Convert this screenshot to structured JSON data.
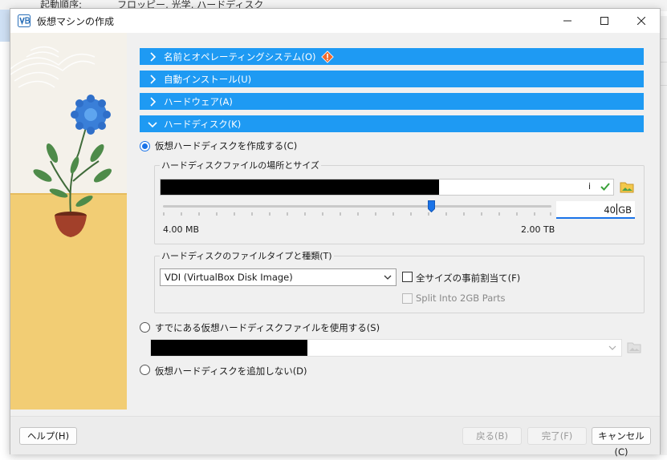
{
  "background": {
    "label": "起動順序:",
    "value": "フロッピー, 光学, ハードディスク"
  },
  "window": {
    "title": "仮想マシンの作成",
    "icon": "virtualbox-icon",
    "controls": [
      "minimize-icon",
      "maximize-icon",
      "close-icon"
    ]
  },
  "sections": [
    {
      "label": "名前とオペレーティングシステム(O)",
      "expanded": false,
      "warning": true
    },
    {
      "label": "自動インストール(U)",
      "expanded": false,
      "warning": false
    },
    {
      "label": "ハードウェア(A)",
      "expanded": false,
      "warning": false
    },
    {
      "label": "ハードディスク(K)",
      "expanded": true,
      "warning": false
    }
  ],
  "harddisk": {
    "create_option": "仮想ハードディスクを作成する(C)",
    "location_group": "ハードディスクファイルの場所とサイズ",
    "path_suffix": "i",
    "size": {
      "value": "40",
      "unit": "GB",
      "min_label": "4.00 MB",
      "max_label": "2.00 TB"
    },
    "type_group": "ハードディスクのファイルタイプと種類(T)",
    "file_type": "VDI (VirtualBox Disk Image)",
    "preallocate_label": "全サイズの事前割当て(F)",
    "split_label": "Split Into 2GB Parts",
    "existing_option": "すでにある仮想ハードディスクファイルを使用する(S)",
    "none_option": "仮想ハードディスクを追加しない(D)",
    "selected": "create"
  },
  "footer": {
    "help": "ヘルプ(H)",
    "back": "戻る(B)",
    "finish": "完了(F)",
    "cancel": "キャンセル(C)"
  },
  "colors": {
    "section_bar": "#1e9af3",
    "accent": "#1a73e8",
    "art_yellow": "#f2cd74"
  }
}
